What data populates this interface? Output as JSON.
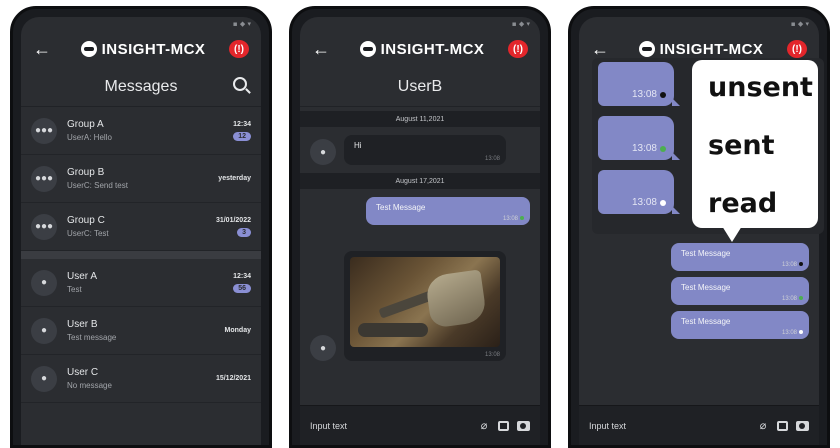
{
  "brand": {
    "name": "INSIGHT-MCX",
    "alert_glyph": "(!)"
  },
  "status_icons": "▪ ◆ ▾",
  "colors": {
    "accent": "#8288c6",
    "badge": "#8a8fd4",
    "alert": "#e3262b",
    "dot_unsent": "#111111",
    "dot_sent": "#4caf50",
    "dot_read": "#ffffff"
  },
  "screen1": {
    "title": "Messages",
    "conversations": [
      {
        "name": "Group A",
        "preview": "UserA: Hello",
        "time": "12:34",
        "badge": "12",
        "icon": "group-icon"
      },
      {
        "name": "Group B",
        "preview": "UserC: Send test",
        "time": "yesterday",
        "badge": "",
        "icon": "group-icon"
      },
      {
        "name": "Group C",
        "preview": "UserC: Test",
        "time": "31/01/2022",
        "badge": "3",
        "icon": "group-icon"
      },
      {
        "name": "User A",
        "preview": "Test",
        "time": "12:34",
        "badge": "56",
        "icon": "user-icon"
      },
      {
        "name": "User B",
        "preview": "Test message",
        "time": "Monday",
        "badge": "",
        "icon": "user-icon"
      },
      {
        "name": "User C",
        "preview": "No message",
        "time": "15/12/2021",
        "badge": "",
        "icon": "user-icon"
      }
    ]
  },
  "screen2": {
    "title": "UserB",
    "date1": "August 11,2021",
    "incoming_text": "Hi",
    "incoming_time": "13:08",
    "date2": "August 17,2021",
    "outgoing_text": "Test Message",
    "outgoing_time": "13:08",
    "photo_time": "13:08",
    "input_placeholder": "Input text"
  },
  "screen3": {
    "messages": [
      {
        "text": "Test Message",
        "time": "13:08",
        "state": "unsent"
      },
      {
        "text": "Test Message",
        "time": "13:08",
        "state": "sent"
      },
      {
        "text": "Test Message",
        "time": "13:08",
        "state": "read"
      }
    ],
    "legend": [
      {
        "time": "13:08",
        "label": "unsent"
      },
      {
        "time": "13:08",
        "label": "sent"
      },
      {
        "time": "13:08",
        "label": "read"
      }
    ],
    "input_placeholder": "Input text"
  }
}
